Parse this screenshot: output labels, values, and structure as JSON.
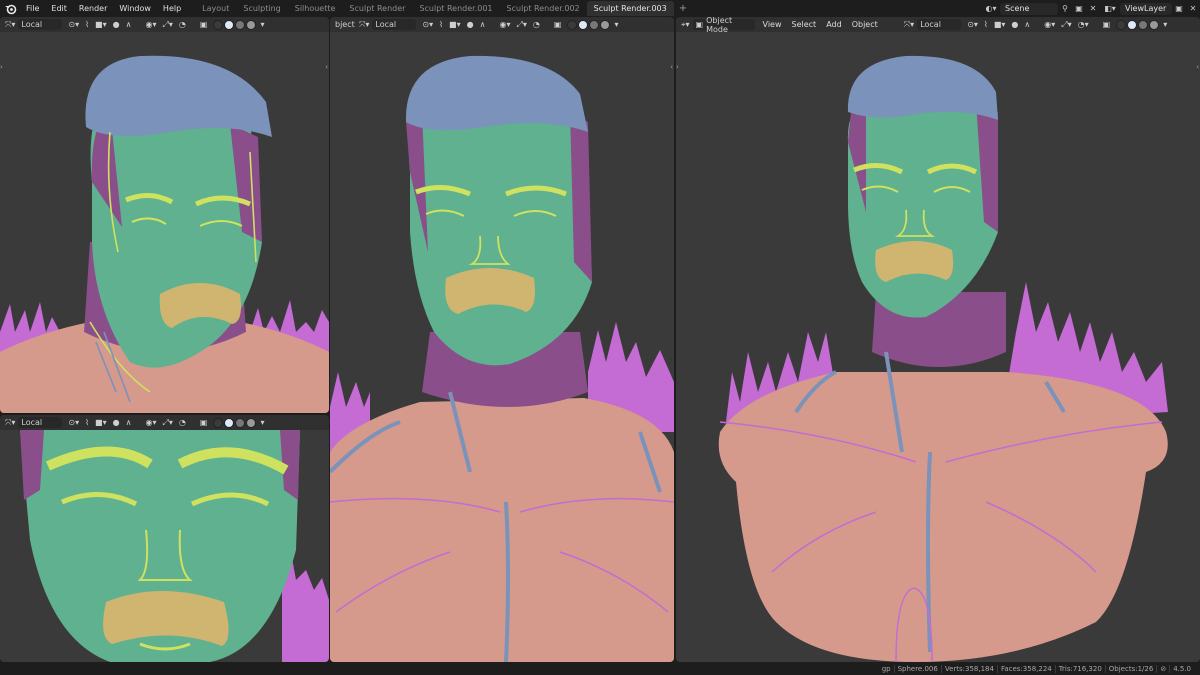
{
  "menu": [
    "File",
    "Edit",
    "Render",
    "Window",
    "Help"
  ],
  "workspaces": [
    "Layout",
    "Sculpting",
    "Silhouette",
    "Sculpt Render",
    "Sculpt Render.001",
    "Sculpt Render.002",
    "Sculpt Render.003"
  ],
  "active_workspace": "Sculpt Render.003",
  "add_tab_glyph": "+",
  "scene": {
    "name": "Scene",
    "view_layer": "ViewLayer"
  },
  "viewports": {
    "top_left": {
      "orientation": "Local"
    },
    "bottom_left": {
      "orientation": "Local"
    },
    "middle": {
      "mode_fragment": "bject",
      "orientation": "Local"
    },
    "right": {
      "mode": "Object Mode",
      "menus": [
        "View",
        "Select",
        "Add",
        "Object"
      ],
      "orientation": "Local"
    }
  },
  "status": {
    "mode": "gp",
    "object": "Sphere.006",
    "verts": "Verts:358,184",
    "faces": "Faces:358,224",
    "tris": "Tris:716,320",
    "objects": "Objects:1/26",
    "version": "4.5.0"
  },
  "colors": {
    "skin": "#d59a8c",
    "face": "#5fb18f",
    "hair": "#7b92ba",
    "neck": "#8a4e8a",
    "stroke_purple": "#c56bd4",
    "stroke_yellow": "#cfe25f",
    "mustache": "#cfb56f",
    "viewport_bg": "#3a3a3a"
  }
}
